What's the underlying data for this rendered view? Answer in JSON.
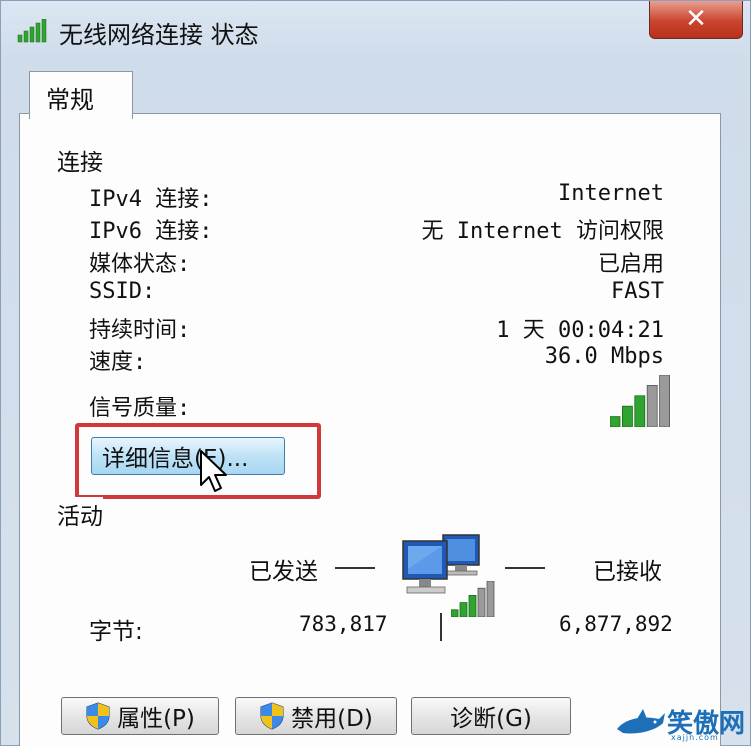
{
  "window": {
    "title": "无线网络连接 状态",
    "close_label": "✕"
  },
  "tabs": [
    {
      "label": "常规"
    }
  ],
  "connection": {
    "group_label": "连接",
    "rows": [
      {
        "label": "IPv4 连接:",
        "value": "Internet"
      },
      {
        "label": "IPv6 连接:",
        "value": "无 Internet 访问权限"
      },
      {
        "label": "媒体状态:",
        "value": "已启用"
      },
      {
        "label": "SSID:",
        "value": "FAST"
      },
      {
        "label": "持续时间:",
        "value": "1 天 00:04:21"
      },
      {
        "label": "速度:",
        "value": "36.0 Mbps"
      }
    ],
    "signal_label": "信号质量:",
    "signal_bars": 3,
    "signal_max": 5,
    "details_button": "详细信息(E)..."
  },
  "activity": {
    "group_label": "活动",
    "sent_label": "已发送",
    "received_label": "已接收",
    "bytes_label": "字节:",
    "bytes_sent": "783,817",
    "bytes_received": "6,877,892"
  },
  "buttons": {
    "properties": "属性(P)",
    "disable": "禁用(D)",
    "diagnose": "诊断(G)"
  },
  "watermark": {
    "text": "笑傲网",
    "sub": "xajjn.com"
  },
  "colors": {
    "signal_green": "#2fa52f",
    "highlight_red": "#d13a3a"
  }
}
